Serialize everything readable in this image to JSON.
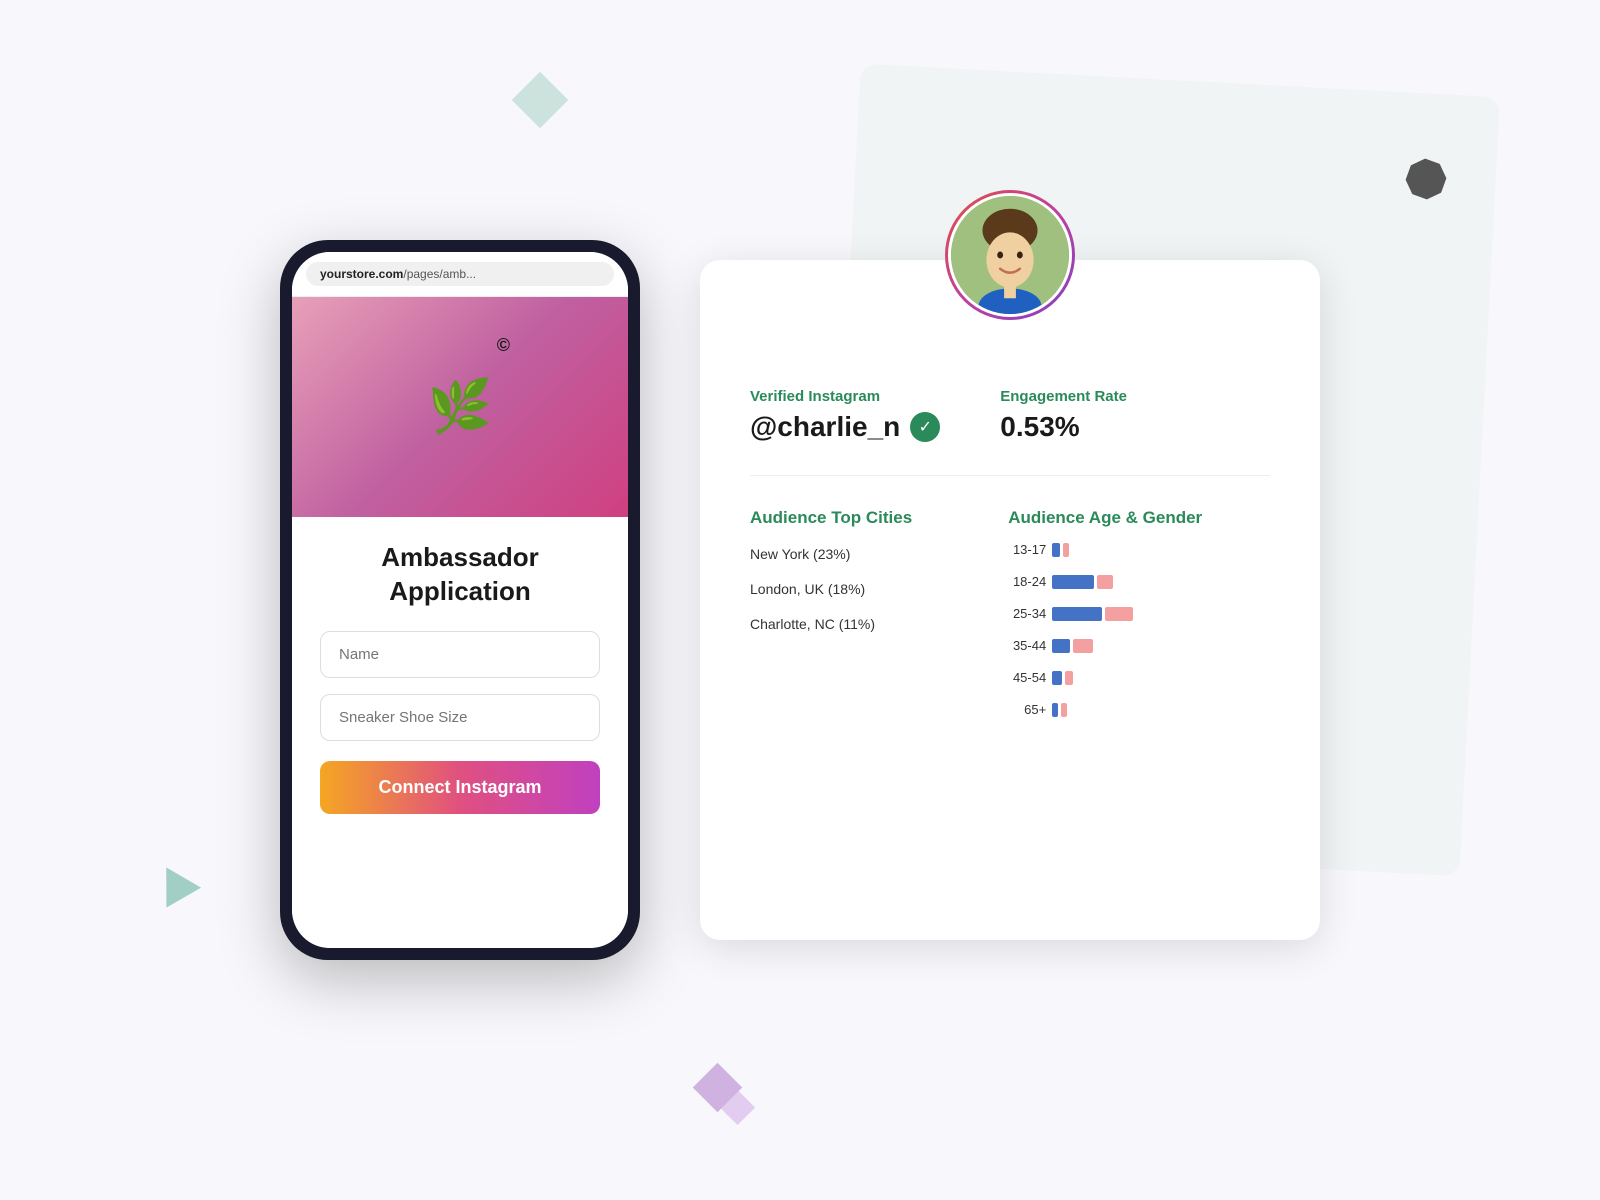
{
  "page": {
    "background_color": "#f8f8fc"
  },
  "phone": {
    "url_bar": {
      "domain": "yourstore.com",
      "path": "/pages/amb..."
    },
    "header": {
      "logo_symbol": "🌿",
      "copyright_symbol": "©"
    },
    "form": {
      "title_line1": "Ambassador",
      "title_line2": "Application",
      "input1_placeholder": "Name",
      "input2_placeholder": "Sneaker Shoe Size",
      "button_label": "Connect Instagram"
    }
  },
  "profile_card": {
    "avatar_emoji": "👨",
    "sections": {
      "verified_instagram": {
        "label": "Verified Instagram",
        "handle": "@charlie_n",
        "verified": true
      },
      "engagement_rate": {
        "label": "Engagement Rate",
        "value": "0.53%"
      },
      "audience_top_cities": {
        "label": "Audience Top Cities",
        "cities": [
          "New York (23%)",
          "London, UK (18%)",
          "Charlotte, NC (11%)"
        ]
      },
      "audience_age_gender": {
        "label": "Audience Age & Gender",
        "rows": [
          {
            "age": "13-17",
            "male_width": 8,
            "female_width": 6
          },
          {
            "age": "18-24",
            "male_width": 42,
            "female_width": 16
          },
          {
            "age": "25-34",
            "male_width": 50,
            "female_width": 28
          },
          {
            "age": "35-44",
            "male_width": 18,
            "female_width": 20
          },
          {
            "age": "45-54",
            "male_width": 10,
            "female_width": 8
          },
          {
            "age": "65+",
            "male_width": 6,
            "female_width": 6
          }
        ]
      }
    }
  },
  "colors": {
    "green": "#2a8a5a",
    "blue_bar": "#4472c4",
    "pink_bar": "#f4a0a0",
    "gradient_start": "#f5a623",
    "gradient_mid": "#e05080",
    "gradient_end": "#c040c0"
  }
}
